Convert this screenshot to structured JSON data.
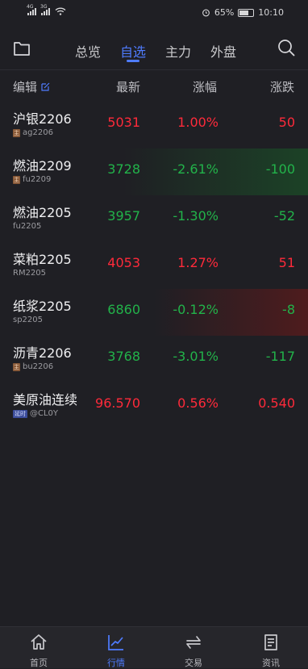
{
  "status": {
    "signal1": "4G",
    "signal2": "3G",
    "battery": "65%",
    "time": "10:10"
  },
  "topnav": {
    "tabs": [
      "总览",
      "自选",
      "主力",
      "外盘"
    ],
    "active": 1
  },
  "header": {
    "edit": "编辑",
    "col1": "最新",
    "col2": "涨幅",
    "col3": "涨跌"
  },
  "rows": [
    {
      "name": "沪银2206",
      "code": "ag2206",
      "badge": "主",
      "latest": "5031",
      "pct": "1.00%",
      "chg": "50",
      "dir": "up",
      "flash": ""
    },
    {
      "name": "燃油2209",
      "code": "fu2209",
      "badge": "主",
      "latest": "3728",
      "pct": "-2.61%",
      "chg": "-100",
      "dir": "down",
      "flash": "green"
    },
    {
      "name": "燃油2205",
      "code": "fu2205",
      "badge": "",
      "latest": "3957",
      "pct": "-1.30%",
      "chg": "-52",
      "dir": "down",
      "flash": ""
    },
    {
      "name": "菜粕2205",
      "code": "RM2205",
      "badge": "",
      "latest": "4053",
      "pct": "1.27%",
      "chg": "51",
      "dir": "up",
      "flash": ""
    },
    {
      "name": "纸浆2205",
      "code": "sp2205",
      "badge": "",
      "latest": "6860",
      "pct": "-0.12%",
      "chg": "-8",
      "dir": "down",
      "flash": "red"
    },
    {
      "name": "沥青2206",
      "code": "bu2206",
      "badge": "主",
      "latest": "3768",
      "pct": "-3.01%",
      "chg": "-117",
      "dir": "down",
      "flash": ""
    },
    {
      "name": "美原油连续",
      "code": "@CL0Y",
      "badge": "延时",
      "latest": "96.570",
      "pct": "0.56%",
      "chg": "0.540",
      "dir": "up",
      "flash": ""
    }
  ],
  "bottomnav": {
    "items": [
      "首页",
      "行情",
      "交易",
      "资讯"
    ],
    "active": 1
  }
}
